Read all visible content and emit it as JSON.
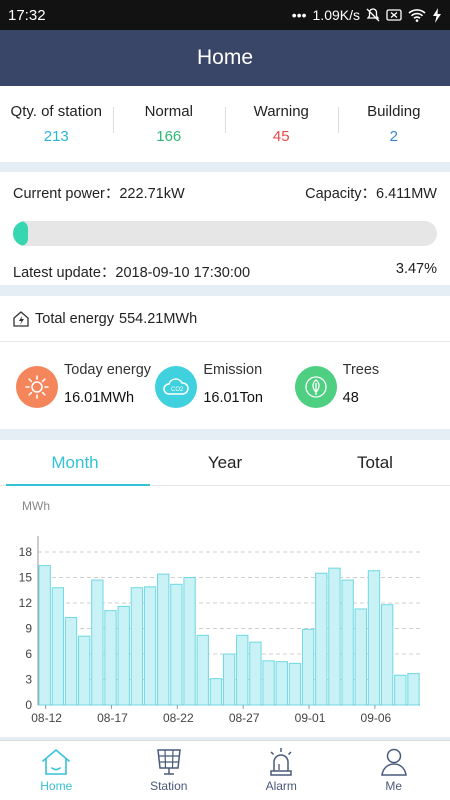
{
  "status_bar": {
    "time": "17:32",
    "dots": "•••",
    "speed": "1.09K/s"
  },
  "header": {
    "title": "Home"
  },
  "stats": [
    {
      "label": "Qty. of station",
      "value": "213",
      "color": "#29b6d6"
    },
    {
      "label": "Normal",
      "value": "166",
      "color": "#2eb872"
    },
    {
      "label": "Warning",
      "value": "45",
      "color": "#e84a4a"
    },
    {
      "label": "Building",
      "value": "2",
      "color": "#3a84d8"
    }
  ],
  "power": {
    "current_power": "Current power：222.71kW",
    "capacity": "Capacity：6.411MW",
    "latest_update": "Latest update：2018-09-10 17:30:00",
    "percent_text": "3.47%",
    "percent_value": 0.0347
  },
  "energy": {
    "total_label": "Total energy",
    "total_value": "554.21MWh",
    "items": [
      {
        "label": "Today energy",
        "value": "16.01MWh",
        "icon": "sun-icon",
        "color": "#f5855a"
      },
      {
        "label": "Emission",
        "value": "16.01Ton",
        "icon": "cloud-co2-icon",
        "color": "#3fd1dd"
      },
      {
        "label": "Trees",
        "value": "48",
        "icon": "leaf-icon",
        "color": "#4fcf82"
      }
    ]
  },
  "tabs": [
    {
      "label": "Month",
      "active": true
    },
    {
      "label": "Year",
      "active": false
    },
    {
      "label": "Total",
      "active": false
    }
  ],
  "chart_data": {
    "type": "bar",
    "ylabel": "MWh",
    "ylim": [
      0,
      18
    ],
    "yticks": [
      0,
      3,
      6,
      9,
      12,
      15,
      18
    ],
    "xtick_labels": [
      "08-12",
      "08-17",
      "08-22",
      "08-27",
      "09-01",
      "09-06"
    ],
    "xtick_indices": [
      0,
      5,
      10,
      15,
      20,
      25
    ],
    "categories": [
      "08-12",
      "08-13",
      "08-14",
      "08-15",
      "08-16",
      "08-17",
      "08-18",
      "08-19",
      "08-20",
      "08-21",
      "08-22",
      "08-23",
      "08-24",
      "08-25",
      "08-26",
      "08-27",
      "08-28",
      "08-29",
      "08-30",
      "08-31",
      "09-01",
      "09-02",
      "09-03",
      "09-04",
      "09-05",
      "09-06",
      "09-07",
      "09-08",
      "09-09"
    ],
    "values": [
      16.4,
      13.8,
      10.3,
      8.1,
      14.7,
      11.1,
      11.6,
      13.8,
      13.9,
      15.4,
      14.2,
      15.0,
      8.2,
      3.1,
      6.0,
      8.2,
      7.4,
      5.2,
      5.1,
      4.9,
      8.9,
      15.5,
      16.1,
      14.7,
      11.3,
      15.8,
      11.8,
      3.5,
      3.7
    ],
    "bar_fill": "#c8f2f5",
    "bar_stroke": "#6fd8e2",
    "grid": true
  },
  "nav": [
    {
      "label": "Home",
      "icon": "home-icon",
      "active": true
    },
    {
      "label": "Station",
      "icon": "solar-panel-icon",
      "active": false
    },
    {
      "label": "Alarm",
      "icon": "alarm-siren-icon",
      "active": false
    },
    {
      "label": "Me",
      "icon": "person-icon",
      "active": false
    }
  ]
}
